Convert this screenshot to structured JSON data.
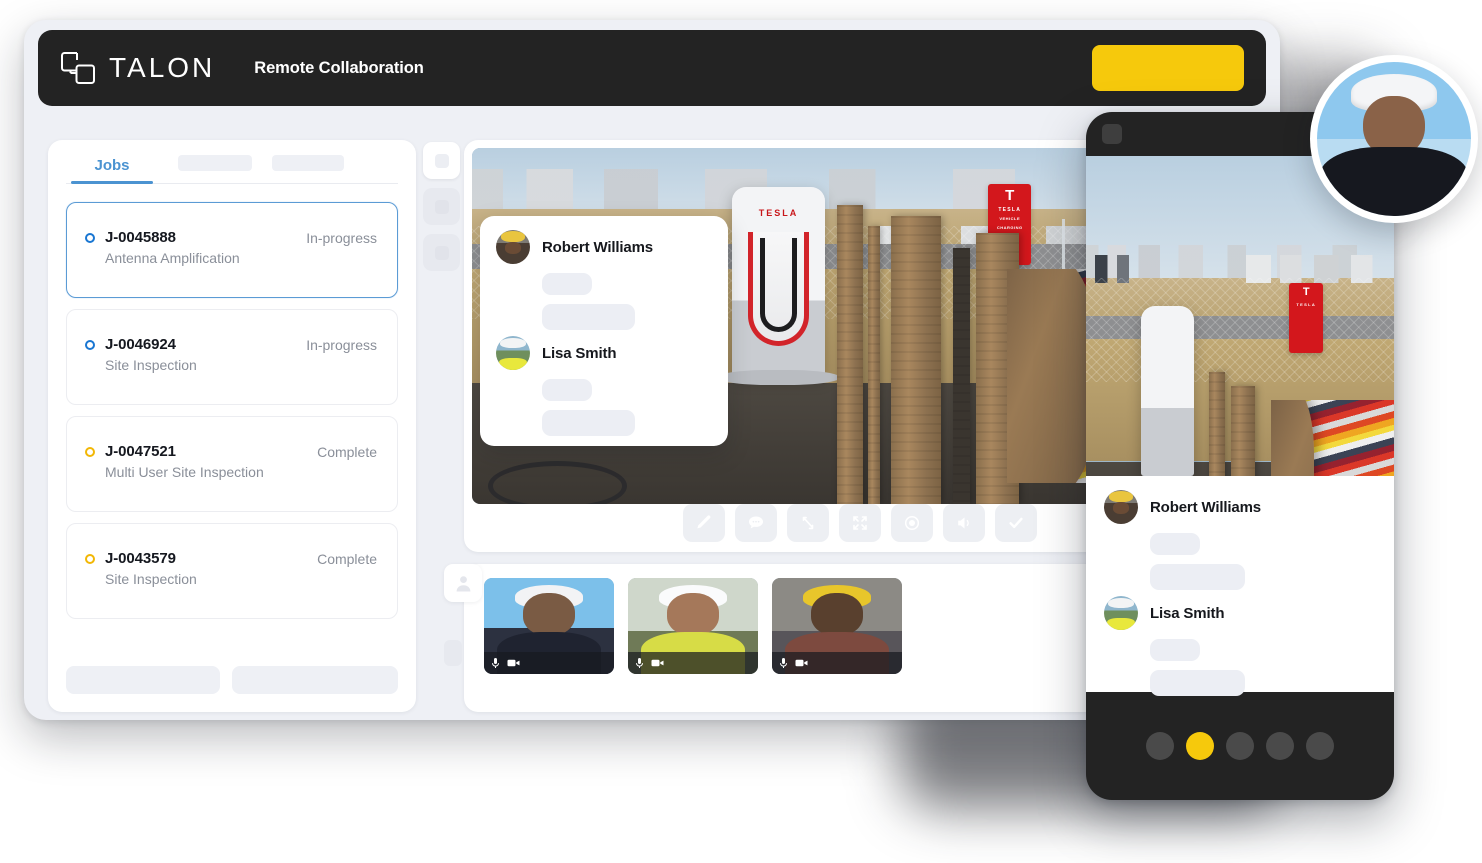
{
  "header": {
    "brand_name": "TALON",
    "logo_icon": "talon-interlocking-squares-logo",
    "subtitle": "Remote Collaboration",
    "cta_label": "",
    "cta_color": "#F6C90C",
    "background": "#232323"
  },
  "sidebar": {
    "tabs": [
      {
        "label": "Jobs",
        "active": true
      },
      {
        "label": "",
        "active": false
      },
      {
        "label": "",
        "active": false
      }
    ],
    "jobs": [
      {
        "id": "J-0045888",
        "description": "Antenna Amplification",
        "status": "In-progress",
        "status_color": "#1976D2",
        "selected": true
      },
      {
        "id": "J-0046924",
        "description": "Site Inspection",
        "status": "In-progress",
        "status_color": "#1976D2",
        "selected": false
      },
      {
        "id": "J-0047521",
        "description": "Multi User Site Inspection",
        "status": "Complete",
        "status_color": "#F2B705",
        "selected": false
      },
      {
        "id": "J-0043579",
        "description": "Site Inspection",
        "status": "Complete",
        "status_color": "#F2B705",
        "selected": false
      }
    ],
    "footer_buttons": [
      "",
      ""
    ]
  },
  "tool_rail": [
    {
      "icon": "square-glyph",
      "active": true
    },
    {
      "icon": "square-glyph",
      "active": false
    },
    {
      "icon": "square-glyph",
      "active": false
    }
  ],
  "video": {
    "scene_description": "Tesla Supercharger station at construction site with cable spools",
    "signage": {
      "charger_label": "TESLA",
      "sign_brand": "TESLA",
      "sign_line1": "VEHICLE",
      "sign_line2": "CHARGING"
    },
    "toolbar": [
      {
        "name": "annotate-pencil-icon",
        "label": ""
      },
      {
        "name": "chat-bubble-icon",
        "label": ""
      },
      {
        "name": "resize-diagonal-icon",
        "label": ""
      },
      {
        "name": "fullscreen-expand-icon",
        "label": ""
      },
      {
        "name": "record-target-icon",
        "label": ""
      },
      {
        "name": "speaker-icon",
        "label": ""
      },
      {
        "name": "check-icon",
        "label": ""
      }
    ]
  },
  "chat": {
    "messages": [
      {
        "name": "Robert Williams",
        "avatar": "robert",
        "bubbles": [
          "",
          ""
        ]
      },
      {
        "name": "Lisa Smith",
        "avatar": "lisa",
        "bubbles": [
          "",
          ""
        ]
      }
    ]
  },
  "participants": {
    "people_icon": "person-icon",
    "thumbs": [
      {
        "mic": "mic-icon",
        "cam": "camera-icon"
      },
      {
        "mic": "mic-icon",
        "cam": "camera-icon"
      },
      {
        "mic": "mic-icon",
        "cam": "camera-icon"
      }
    ]
  },
  "phone": {
    "menu_icon": "menu-square-icon",
    "chat": {
      "messages": [
        {
          "name": "Robert Williams",
          "avatar": "robert",
          "bubbles": [
            "",
            ""
          ]
        },
        {
          "name": "Lisa Smith",
          "avatar": "lisa",
          "bubbles": [
            "",
            ""
          ]
        }
      ]
    },
    "dots": [
      {
        "active": false
      },
      {
        "active": true
      },
      {
        "active": false
      },
      {
        "active": false
      },
      {
        "active": false
      }
    ],
    "accent_color": "#F6C90C"
  },
  "hero_avatar": {
    "alt": "field-technician-with-hardhat"
  }
}
